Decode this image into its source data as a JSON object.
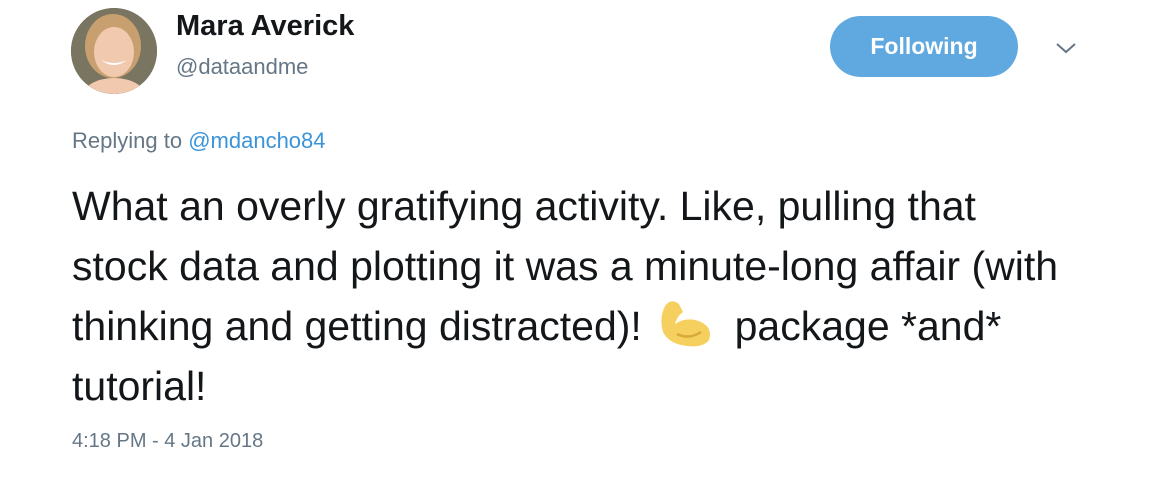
{
  "user": {
    "name": "Mara Averick",
    "handle": "@dataandme"
  },
  "follow_button": {
    "label": "Following",
    "color": "#5fa9e0"
  },
  "menu": {
    "icon": "chevron-down-icon"
  },
  "reply": {
    "prefix": "Replying to",
    "target": "@mdancho84"
  },
  "tweet": {
    "text_before": "What an overly gratifying activity. Like, pulling that stock data and plotting it was a minute-long affair (with thinking and getting distracted)!",
    "emoji": "flexed-biceps-icon",
    "text_after": "package *and* tutorial!"
  },
  "timestamp": "4:18 PM - 4 Jan 2018"
}
